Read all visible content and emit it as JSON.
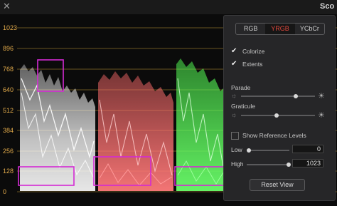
{
  "window": {
    "close_icon": "close-icon",
    "title": "Sco"
  },
  "scope": {
    "y_axis_labels": [
      "1023",
      "896",
      "768",
      "640",
      "512",
      "384",
      "256",
      "128",
      "0"
    ],
    "label_color": "#e0a94a"
  },
  "settings_panel": {
    "modes": [
      "RGB",
      "YRGB",
      "YCbCr"
    ],
    "selected_mode": "YRGB",
    "colorize_label": "Colorize",
    "colorize_checked": true,
    "extents_label": "Extents",
    "extents_checked": true,
    "parade_label": "Parade",
    "parade_level": 0.82,
    "graticule_label": "Graticule",
    "graticule_level": 0.55,
    "show_reference_levels_label": "Show Reference Levels",
    "show_reference_levels_checked": false,
    "low_label": "Low",
    "low_value": "0",
    "high_label": "High",
    "high_value": "1023",
    "reset_button_label": "Reset View"
  }
}
